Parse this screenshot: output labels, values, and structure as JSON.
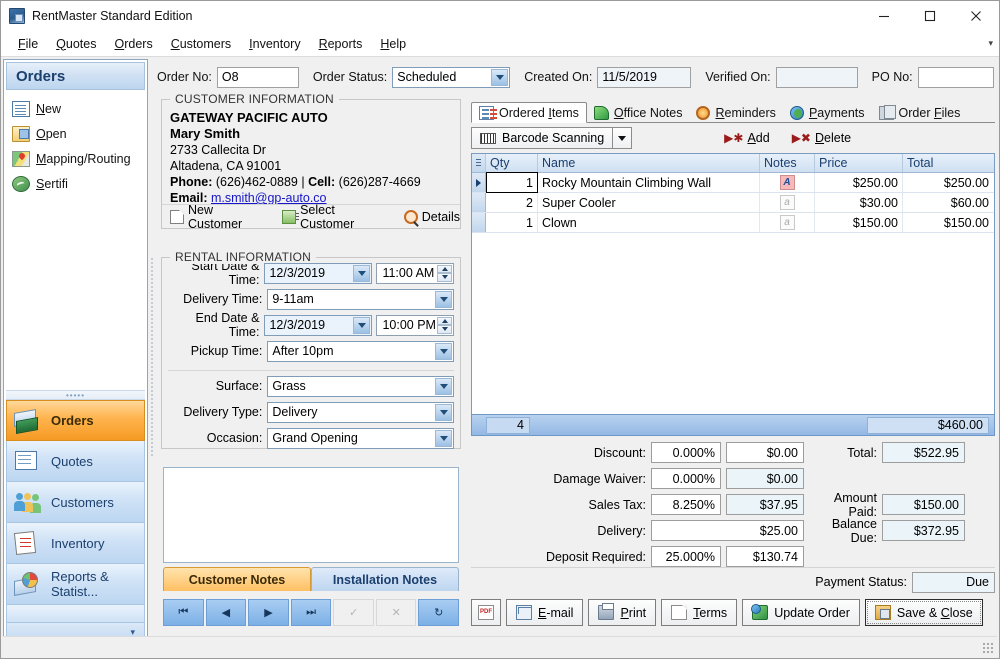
{
  "window": {
    "title": "RentMaster Standard Edition",
    "minimize": "—",
    "maximize": "□",
    "close": "✕"
  },
  "menubar": {
    "items": [
      {
        "label": "File",
        "accel": "F"
      },
      {
        "label": "Quotes",
        "accel": "Q"
      },
      {
        "label": "Orders",
        "accel": "O"
      },
      {
        "label": "Customers",
        "accel": "C"
      },
      {
        "label": "Inventory",
        "accel": "I"
      },
      {
        "label": "Reports",
        "accel": "R"
      },
      {
        "label": "Help",
        "accel": "H"
      }
    ],
    "overflow": "▾"
  },
  "sidebar": {
    "header": "Orders",
    "links": [
      {
        "label": "New",
        "icon": "document-icon"
      },
      {
        "label": "Open",
        "icon": "open-folder-icon"
      },
      {
        "label": "Mapping/Routing",
        "icon": "map-pin-icon"
      },
      {
        "label": "Sertifi",
        "icon": "sertifi-icon"
      }
    ],
    "buttons": [
      {
        "label": "Orders",
        "icon": "orders-icon",
        "active": true
      },
      {
        "label": "Quotes",
        "icon": "quotes-icon",
        "active": false
      },
      {
        "label": "Customers",
        "icon": "customers-icon",
        "active": false
      },
      {
        "label": "Inventory",
        "icon": "inventory-icon",
        "active": false
      },
      {
        "label": "Reports & Statist...",
        "icon": "reports-icon",
        "active": false
      }
    ],
    "more_chevron": "▾"
  },
  "order_header": {
    "order_no_label": "Order No:",
    "order_no_value": "O8",
    "order_status_label": "Order Status:",
    "order_status_value": "Scheduled",
    "created_on_label": "Created On:",
    "created_on_value": "11/5/2019",
    "verified_on_label": "Verified On:",
    "verified_on_value": "",
    "po_no_label": "PO No:",
    "po_no_value": ""
  },
  "customer": {
    "legend": "CUSTOMER INFORMATION",
    "company": "GATEWAY PACIFIC AUTO",
    "contact": "Mary Smith",
    "address1": "2733 Callecita Dr",
    "address2": "Altadena, CA 91001",
    "phone_label": "Phone:",
    "phone": "(626)462-0889",
    "separator": "|",
    "cell_label": "Cell:",
    "cell": "(626)287-4669",
    "email_label": "Email:",
    "email": "m.smith@gp-auto.co",
    "actions": [
      {
        "label": "New Customer",
        "icon": "new-customer-icon"
      },
      {
        "label": "Select Customer",
        "icon": "select-customer-icon"
      },
      {
        "label": "Details",
        "icon": "magnifier-icon"
      }
    ]
  },
  "rental": {
    "legend": "RENTAL INFORMATION",
    "start_label": "Start Date & Time:",
    "start_date": "12/3/2019",
    "start_time": "11:00 AM",
    "delivery_time_label": "Delivery Time:",
    "delivery_time": "9-11am",
    "end_label": "End Date & Time:",
    "end_date": "12/3/2019",
    "end_time": "10:00 PM",
    "pickup_time_label": "Pickup Time:",
    "pickup_time": "After 10pm",
    "surface_label": "Surface:",
    "surface": "Grass",
    "delivery_type_label": "Delivery Type:",
    "delivery_type": "Delivery",
    "occasion_label": "Occasion:",
    "occasion": "Grand Opening"
  },
  "notes": {
    "content": "",
    "tabs": [
      {
        "label": "Customer Notes",
        "active": true
      },
      {
        "label": "Installation Notes",
        "active": false
      }
    ],
    "nav": [
      {
        "name": "first-record",
        "glyph": "⏮",
        "enabled": true
      },
      {
        "name": "previous-record",
        "glyph": "◀",
        "enabled": true
      },
      {
        "name": "next-record",
        "glyph": "▶",
        "enabled": true
      },
      {
        "name": "last-record",
        "glyph": "⏭",
        "enabled": true
      },
      {
        "name": "accept-record",
        "glyph": "✓",
        "enabled": false
      },
      {
        "name": "cancel-record",
        "glyph": "✕",
        "enabled": false
      },
      {
        "name": "refresh-record",
        "glyph": "↻",
        "enabled": true
      }
    ]
  },
  "tabs": [
    {
      "label": "Ordered Items",
      "accel": "I",
      "icon": "ordered-items-icon",
      "active": true
    },
    {
      "label": "Office Notes",
      "accel": "O",
      "icon": "office-notes-icon",
      "active": false
    },
    {
      "label": "Reminders",
      "accel": "R",
      "icon": "reminders-icon",
      "active": false
    },
    {
      "label": "Payments",
      "accel": "P",
      "icon": "payments-icon",
      "active": false
    },
    {
      "label": "Order Files",
      "accel": "F",
      "icon": "order-files-icon",
      "active": false
    }
  ],
  "items_toolbar": {
    "barcode_label": "Barcode Scanning",
    "barcode_dropdown": "▾",
    "add_label": "Add",
    "add_accel": "A",
    "add_glyph": "▶✱",
    "delete_label": "Delete",
    "delete_accel": "D",
    "delete_glyph": "▶✖"
  },
  "grid": {
    "columns": [
      "Qty",
      "Name",
      "Notes",
      "Price",
      "Total"
    ],
    "rows": [
      {
        "qty": "1",
        "name": "Rocky Mountain Climbing Wall",
        "note": "A",
        "note_filled": true,
        "price": "$250.00",
        "total": "$250.00",
        "current": true
      },
      {
        "qty": "2",
        "name": "Super Cooler",
        "note": "a",
        "note_filled": false,
        "price": "$30.00",
        "total": "$60.00",
        "current": false
      },
      {
        "qty": "1",
        "name": "Clown",
        "note": "a",
        "note_filled": false,
        "price": "$150.00",
        "total": "$150.00",
        "current": false
      }
    ],
    "footer_qty": "4",
    "footer_total": "$460.00"
  },
  "totals": {
    "discount_label": "Discount:",
    "discount_pct": "0.000%",
    "discount_amt": "$0.00",
    "damage_waiver_label": "Damage Waiver:",
    "damage_waiver_pct": "0.000%",
    "damage_waiver_amt": "$0.00",
    "sales_tax_label": "Sales Tax:",
    "sales_tax_pct": "8.250%",
    "sales_tax_amt": "$37.95",
    "delivery_label": "Delivery:",
    "delivery_amt": "$25.00",
    "deposit_label": "Deposit Required:",
    "deposit_pct": "25.000%",
    "deposit_amt": "$130.74",
    "total_label": "Total:",
    "total_amt": "$522.95",
    "amount_paid_label": "Amount Paid:",
    "amount_paid_amt": "$150.00",
    "balance_due_label": "Balance Due:",
    "balance_due_amt": "$372.95",
    "payment_status_label": "Payment Status:",
    "payment_status_value": "Due"
  },
  "actions": [
    {
      "label": "",
      "icon": "pdf-icon",
      "accel": "",
      "default": false
    },
    {
      "label": "E-mail",
      "icon": "email-icon",
      "accel": "E",
      "default": false
    },
    {
      "label": "Print",
      "icon": "print-icon",
      "accel": "P",
      "default": false
    },
    {
      "label": "Terms",
      "icon": "terms-icon",
      "accel": "T",
      "default": false
    },
    {
      "label": "Update Order",
      "icon": "update-order-icon",
      "accel": "",
      "default": false
    },
    {
      "label": "Save & Close",
      "icon": "save-icon",
      "accel": "C",
      "default": true
    }
  ]
}
